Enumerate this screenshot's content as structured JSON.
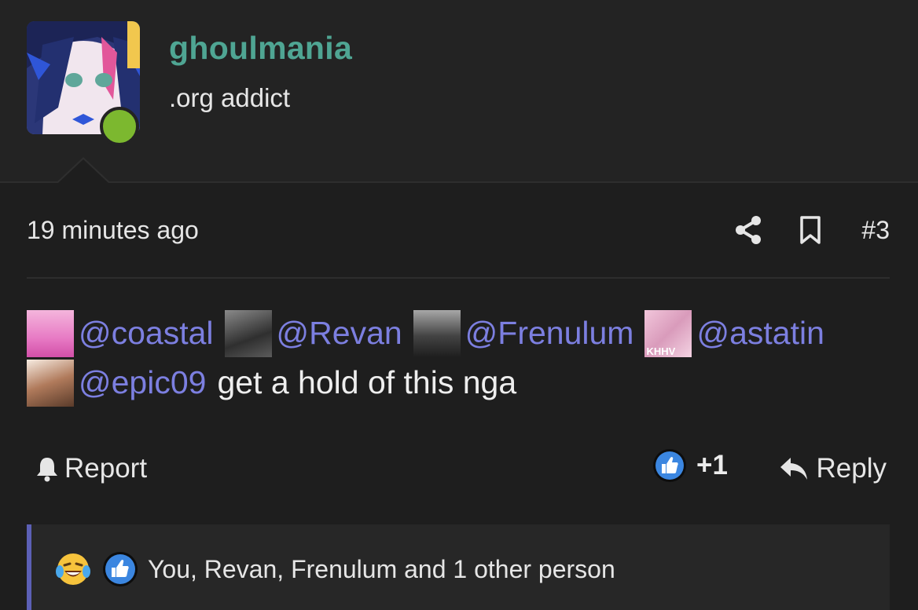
{
  "post": {
    "username": "ghoulmania",
    "user_title": ".org addict",
    "timestamp": "19 minutes ago",
    "post_number": "#3",
    "content": {
      "line1": [
        {
          "mention": "@coastal",
          "avatar_colors": [
            "#f4b5dc",
            "#d24fa8"
          ]
        },
        {
          "mention": "@Revan",
          "avatar_colors": [
            "#8a8a8a",
            "#2f2f2f"
          ]
        },
        {
          "mention": "@Frenulum",
          "avatar_colors": [
            "#a7a7a7",
            "#1e1e1e"
          ]
        },
        {
          "mention": "@astatin",
          "avatar_colors": [
            "#f2c6db",
            "#d99bbb"
          ],
          "avatar_text": "KHHV"
        }
      ],
      "line2": {
        "mention": "@epic09",
        "avatar_colors": [
          "#f7ece2",
          "#5a3b2a"
        ],
        "text": "get a hold of this nga"
      }
    },
    "actions": {
      "report_label": "Report",
      "like_count": "+1",
      "reply_label": "Reply"
    },
    "reactions": {
      "summary": "You, Revan, Frenulum and 1 other person",
      "icons": [
        "laughing-crying-emoji",
        "like-emoji"
      ]
    }
  },
  "colors": {
    "username": "#4fa593",
    "mention": "#7c7fe0",
    "online": "#7cb82f",
    "like_blue": "#3b86e0",
    "reaction_bar_accent": "#5c60b6"
  }
}
